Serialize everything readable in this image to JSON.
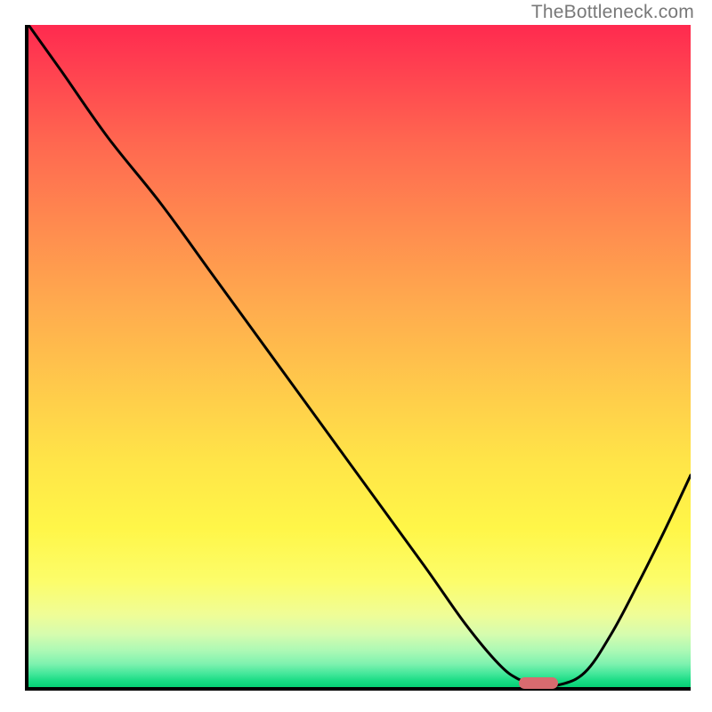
{
  "watermark": "TheBottleneck.com",
  "chart_data": {
    "type": "line",
    "title": "",
    "xlabel": "",
    "ylabel": "",
    "xlim": [
      0,
      100
    ],
    "ylim": [
      0,
      100
    ],
    "x": [
      0,
      5,
      12,
      20,
      28,
      36,
      44,
      52,
      60,
      66,
      71,
      74,
      77,
      80,
      84,
      88,
      92,
      96,
      100
    ],
    "values": [
      100,
      93,
      83,
      73,
      62,
      51,
      40,
      29,
      18,
      9.5,
      3.5,
      1.2,
      0.3,
      0.3,
      2.2,
      8.0,
      15.5,
      23.5,
      32
    ],
    "marker": {
      "x_start": 74,
      "x_end": 80,
      "y": 0.6
    },
    "grid": false,
    "background_gradient": {
      "top_color": "#ff2a4f",
      "bottom_color": "#05d175"
    }
  }
}
